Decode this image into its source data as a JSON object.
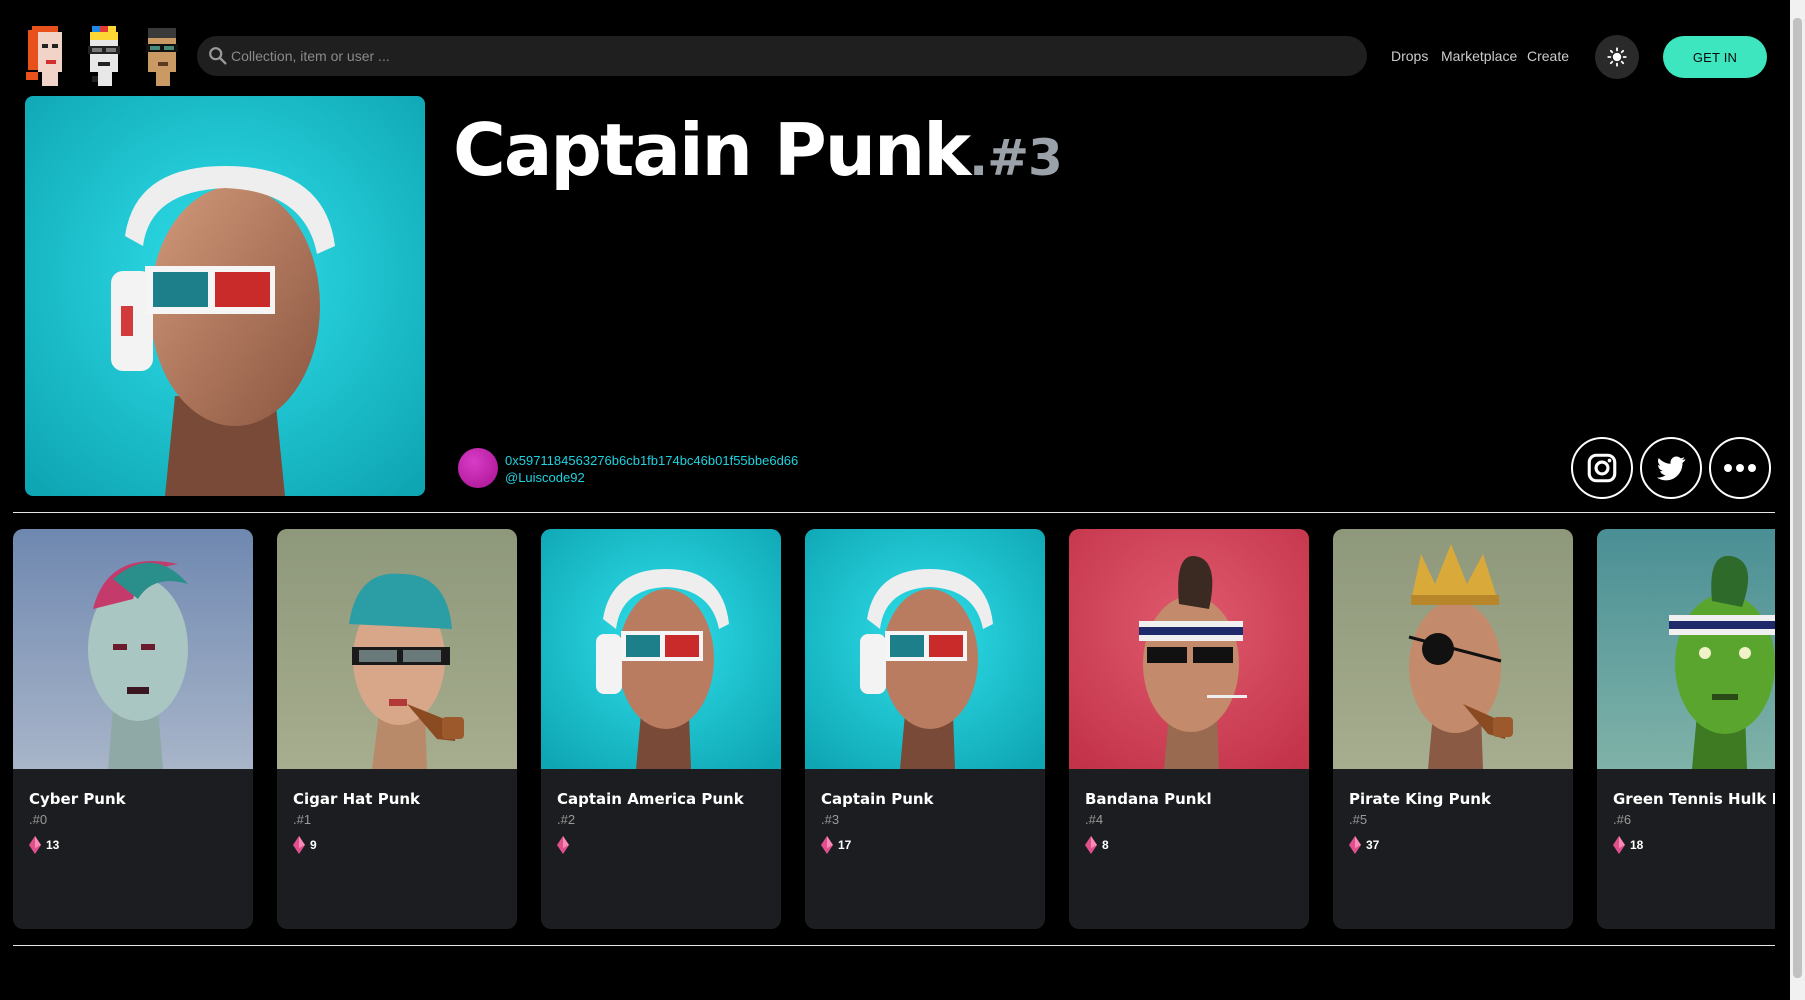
{
  "header": {
    "logos": [
      "punk-logo-red-hair-icon",
      "punk-logo-cap-glasses-icon",
      "punk-logo-sunglasses-icon"
    ],
    "search": {
      "placeholder": "Collection, item or user ...",
      "icon": "search-icon"
    },
    "nav": [
      {
        "label": "Drops"
      },
      {
        "label": "Marketplace"
      },
      {
        "label": "Create"
      }
    ],
    "theme_icon": "sun-icon",
    "getin_label": "GET IN",
    "accent": "#3ee6bf"
  },
  "item": {
    "name": "Captain Punk",
    "number": ".#3",
    "owner": {
      "address": "0x5971184563276b6cb1fb174bc46b01f55bbe6d66",
      "handle": "@Luiscode92"
    },
    "social": [
      "instagram-icon",
      "twitter-icon",
      "more-icon"
    ],
    "link_color": "#20d2e0"
  },
  "collection": {
    "cards": [
      {
        "name": "Cyber Punk",
        "number": ".#0",
        "likes": "13"
      },
      {
        "name": "Cigar Hat Punk",
        "number": ".#1",
        "likes": "9"
      },
      {
        "name": "Captain America Punk",
        "number": ".#2",
        "likes": ""
      },
      {
        "name": "Captain Punk",
        "number": ".#3",
        "likes": "17"
      },
      {
        "name": "Bandana Punkl",
        "number": ".#4",
        "likes": "8"
      },
      {
        "name": "Pirate King Punk",
        "number": ".#5",
        "likes": "37"
      },
      {
        "name": "Green Tennis Hulk Punk",
        "number": ".#6",
        "likes": "18"
      }
    ],
    "like_icon": "ethereum-gem-icon"
  }
}
